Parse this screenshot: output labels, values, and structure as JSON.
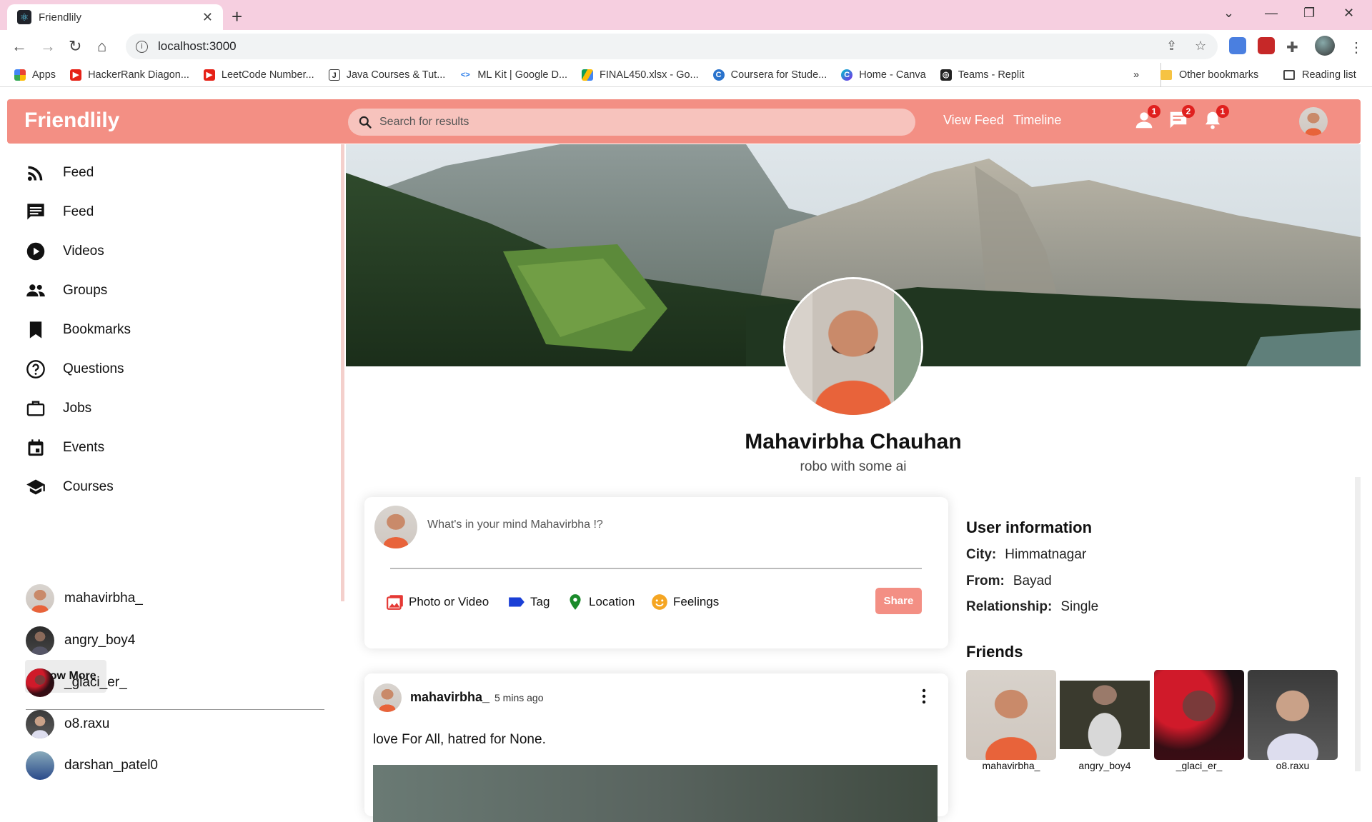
{
  "browser": {
    "tab_title": "Friendlily",
    "url": "localhost:3000",
    "bookmarks": [
      {
        "label": "Apps",
        "color": "#4285f4"
      },
      {
        "label": "HackerRank Diagon...",
        "color": "#e62117"
      },
      {
        "label": "LeetCode Number...",
        "color": "#e62117"
      },
      {
        "label": "Java Courses & Tut...",
        "color": "#333333"
      },
      {
        "label": "ML Kit  |  Google D...",
        "color": "#1a73e8"
      },
      {
        "label": "FINAL450.xlsx - Go...",
        "color": "#0f9d58"
      },
      {
        "label": "Coursera for Stude...",
        "color": "#2a73cc"
      },
      {
        "label": "Home - Canva",
        "color": "#00c4cc"
      },
      {
        "label": "Teams - Replit",
        "color": "#222222"
      }
    ],
    "other_bookmarks": "Other bookmarks",
    "reading_list": "Reading list",
    "more_bookmarks": "»"
  },
  "header": {
    "logo": "Friendlily",
    "search_placeholder": "Search for results",
    "links": [
      "View Feed",
      "Timeline"
    ],
    "badges": {
      "friends": "1",
      "messages": "2",
      "notifications": "1"
    },
    "brand_color": "#f38f84"
  },
  "sidebar": {
    "items": [
      {
        "label": "Feed",
        "icon": "rss-icon"
      },
      {
        "label": "Feed",
        "icon": "chat-icon"
      },
      {
        "label": "Videos",
        "icon": "play-circle-icon"
      },
      {
        "label": "Groups",
        "icon": "group-icon"
      },
      {
        "label": "Bookmarks",
        "icon": "bookmark-icon"
      },
      {
        "label": "Questions",
        "icon": "help-circle-icon"
      },
      {
        "label": "Jobs",
        "icon": "briefcase-icon"
      },
      {
        "label": "Events",
        "icon": "calendar-icon"
      },
      {
        "label": "Courses",
        "icon": "school-icon"
      }
    ],
    "show_more": "Show More",
    "friends": [
      "mahavirbha_",
      "angry_boy4",
      "_glaci_er_",
      "o8.raxu",
      "darshan_patel0"
    ]
  },
  "profile": {
    "name": "Mahavirbha Chauhan",
    "description": "robo with some ai"
  },
  "composer": {
    "placeholder": "What's in your mind Mahavirbha !?",
    "options": [
      "Photo or Video",
      "Tag",
      "Location",
      "Feelings"
    ],
    "share": "Share"
  },
  "post": {
    "username": "mahavirbha_",
    "time": "5 mins ago",
    "text": "love For All, hatred for None."
  },
  "user_info": {
    "title": "User information",
    "rows": [
      {
        "key": "City:",
        "value": "Himmatnagar"
      },
      {
        "key": "From:",
        "value": "Bayad"
      },
      {
        "key": "Relationship:",
        "value": "Single"
      }
    ]
  },
  "friends_panel": {
    "title": "Friends",
    "friends": [
      "mahavirbha_",
      "angry_boy4",
      "_glaci_er_",
      "o8.raxu"
    ]
  }
}
